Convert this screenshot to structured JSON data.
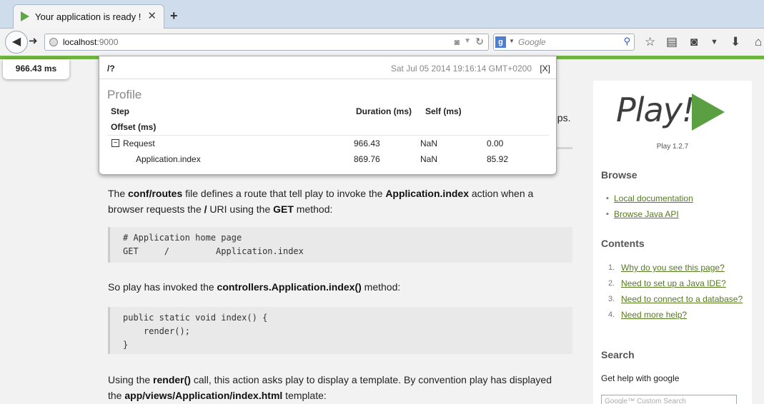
{
  "browser": {
    "tab_title": "Your application is ready !",
    "tab_close": "✕",
    "new_tab": "+",
    "url_host": "localhost",
    "url_port": ":9000",
    "search_engine_badge": "g",
    "search_placeholder": "Google",
    "icons": [
      "back-arrow-icon",
      "forward-arrow-icon",
      "globe-icon",
      "pocket-icon",
      "reload-icon",
      "search-icon",
      "bookmark-star-icon",
      "reading-list-icon",
      "pocket-toolbar-icon",
      "download-icon",
      "home-icon"
    ]
  },
  "timer": {
    "label": "966.43 ms"
  },
  "profile": {
    "path": "/?",
    "timestamp": "Sat Jul 05 2014 19:16:14 GMT+0200",
    "close_label": "[X]",
    "title": "Profile",
    "headers": {
      "step": "Step",
      "duration": "Duration (ms)",
      "self": "Self (ms)",
      "offset": "Offset (ms)"
    },
    "toggle": "−",
    "rows": [
      {
        "step": "Request",
        "duration": "966.43",
        "self": "NaN",
        "offset": "0.00"
      },
      {
        "step": "Application.index",
        "duration": "869.76",
        "self": "NaN",
        "offset": "85.92"
      }
    ]
  },
  "page": {
    "partial_line_end": "eps.",
    "para1": {
      "t1": "The ",
      "b1": "conf/routes",
      "t2": " file defines a route that tell play to invoke the ",
      "b2": "Application.index",
      "t3": " action when a browser requests the ",
      "b3": "/",
      "t4": " URI using the ",
      "b4": "GET",
      "t5": " method:"
    },
    "code1": "# Application home page\nGET     /         Application.index",
    "para2": {
      "t1": "So play has invoked the ",
      "b1": "controllers.Application.index()",
      "t2": " method:"
    },
    "code2": "public static void index() {\n    render();\n}",
    "para3": {
      "t1": "Using the ",
      "b1": "render()",
      "t2": " call, this action asks play to display a template. By convention play has displayed the ",
      "b2": "app/views/Application/index.html",
      "t3": " template:"
    }
  },
  "sidebar": {
    "logo_text": "Play!",
    "version": "Play 1.2.7",
    "browse_heading": "Browse",
    "browse_links": [
      "Local documentation",
      "Browse Java API"
    ],
    "contents_heading": "Contents",
    "contents_links": [
      {
        "num": "1.",
        "label": "Why do you see this page?"
      },
      {
        "num": "2.",
        "label": "Need to set up a Java IDE?"
      },
      {
        "num": "3.",
        "label": "Need to connect to a database?"
      },
      {
        "num": "4.",
        "label": "Need more help?"
      }
    ],
    "search_heading": "Search",
    "search_text": "Get help with google",
    "search_input_placeholder": "Google™ Custom Search"
  }
}
